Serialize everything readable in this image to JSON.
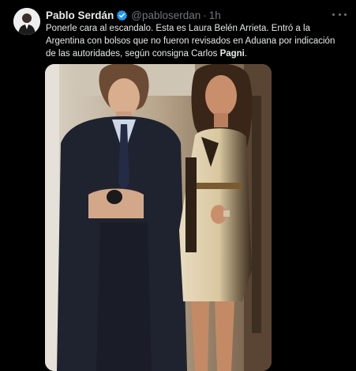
{
  "author": {
    "display_name": "Pablo Serdán",
    "handle": "@pabloserdan",
    "separator": "·",
    "time": "1h",
    "verified_color": "#1d9bf0"
  },
  "tweet": {
    "text_before": "Ponerle cara al escandalo. Esta es Laura Belén Arrieta. Entró a la Argentina con bolsos que no fueron revisados en Aduana por indicación de las autoridades, según consigna Carlos ",
    "text_bold": "Pagni",
    "text_after": "."
  },
  "icons": {
    "more": "more-horizontal-icon",
    "verified": "verified-badge-icon"
  }
}
